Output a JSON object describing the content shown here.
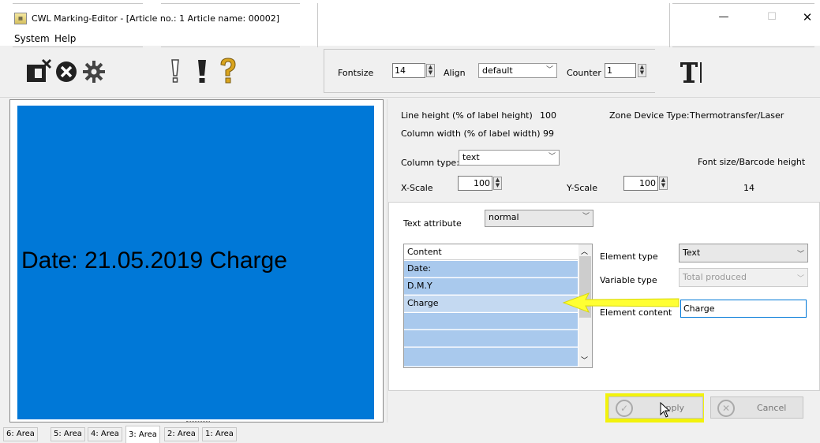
{
  "window": {
    "title": "CWL Marking-Editor - [Article no.: 1   Article name: 00002]",
    "controls": {
      "minimize": "—",
      "maximize": "☐",
      "close": "✕"
    }
  },
  "menu": {
    "items": [
      "System",
      "Help"
    ]
  },
  "toolbar": {
    "fontsize_label": "Fontsize",
    "fontsize_value": "14",
    "align_label": "Align",
    "align_value": "default",
    "counter_label": "Counter",
    "counter_value": "1",
    "icons": [
      "close-editor-icon",
      "cancel-circle-icon",
      "settings-gear-icon",
      "exclamation-icon",
      "exclamation-bold-icon",
      "help-question-icon",
      "text-cursor-icon"
    ]
  },
  "preview": {
    "text": "Date:  21.05.2019 Charge",
    "background": "#0078d7"
  },
  "properties": {
    "line_height_label": "Line height (% of label height)",
    "line_height_value": "100",
    "column_width_label": "Column width (% of label width) 99",
    "zone_device_label": "Zone Device Type:",
    "zone_device_value": "Thermotransfer/Laser",
    "column_type_label": "Column type:",
    "column_type_value": "text",
    "font_size_label": "Font size/Barcode height",
    "font_size_value": "14",
    "x_scale_label": "X-Scale",
    "x_scale_value": "100",
    "y_scale_label": "Y-Scale",
    "y_scale_value": "100"
  },
  "attributes": {
    "text_attribute_label": "Text attribute",
    "text_attribute_value": "normal",
    "content_header": "Content",
    "content_rows": [
      "Date:",
      "D.M.Y",
      "Charge",
      "",
      "",
      ""
    ],
    "element_type_label": "Element type",
    "element_type_value": "Text",
    "variable_type_label": "Variable type",
    "variable_type_value": "Total produced",
    "element_content_label": "Element content",
    "element_content_value": "Charge"
  },
  "buttons": {
    "apply": "Apply",
    "cancel": "Cancel"
  },
  "tabs": [
    "6: Area",
    "5: Area",
    "4: Area",
    "3: Area",
    "2: Area",
    "1: Area"
  ],
  "active_tab": "3: Area",
  "colors": {
    "highlight": "#f2f20c",
    "arrow": "#ffff33",
    "accent": "#0078d7"
  }
}
